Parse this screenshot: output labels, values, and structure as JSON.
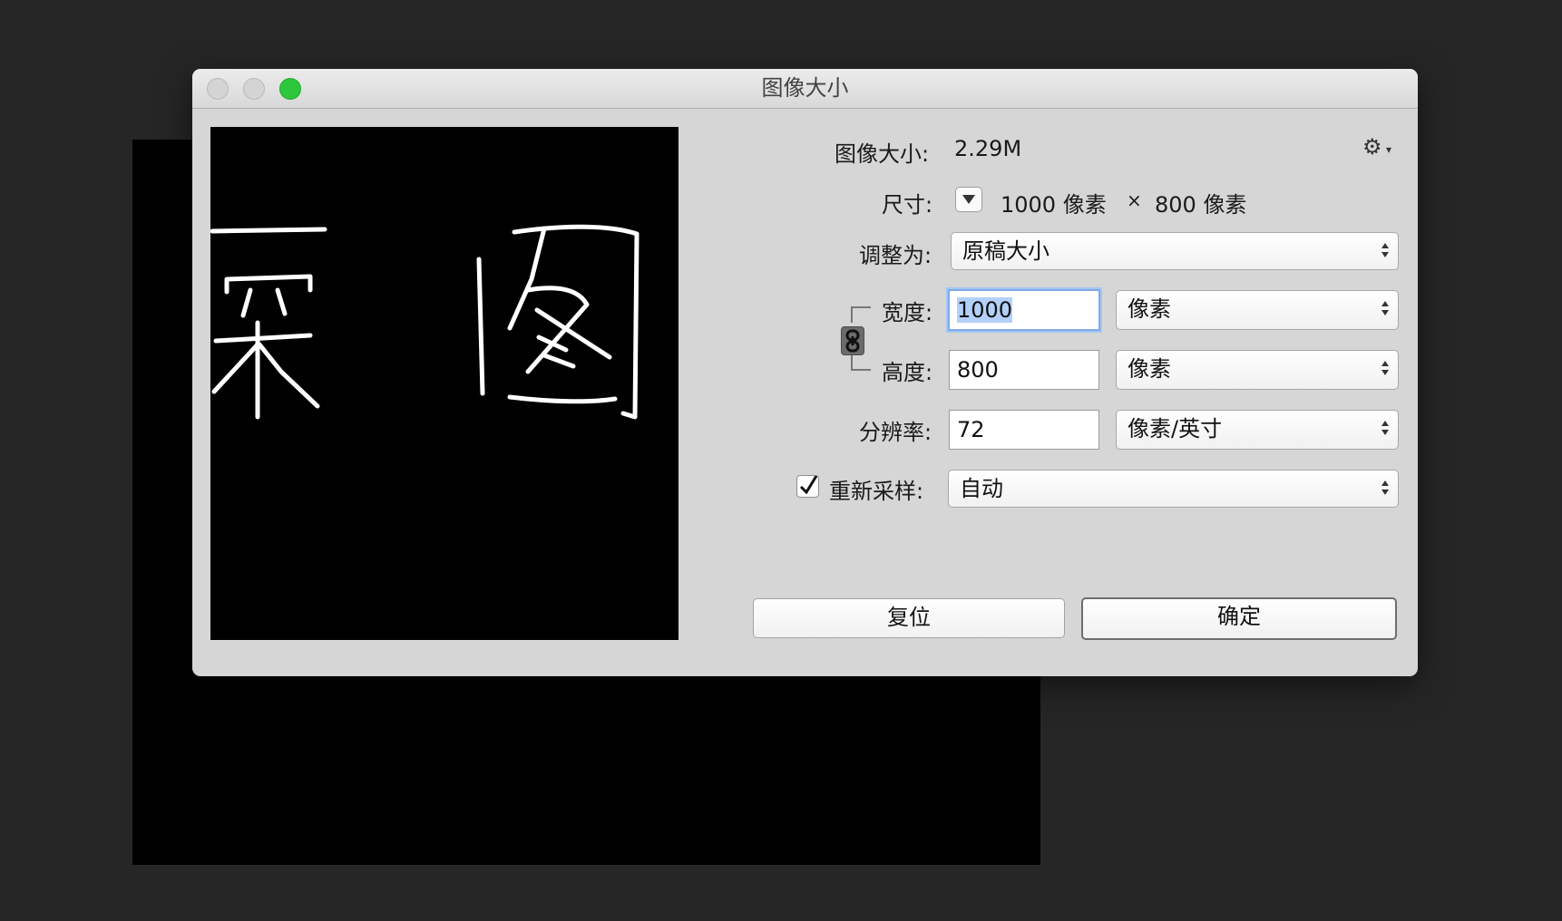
{
  "window": {
    "title": "图像大小"
  },
  "info": {
    "size_label": "图像大小:",
    "size_value": "2.29M",
    "dimensions_label": "尺寸:",
    "width_px": "1000 像素",
    "times": "×",
    "height_px": "800 像素"
  },
  "fit_to": {
    "label": "调整为:",
    "value": "原稿大小"
  },
  "width": {
    "label": "宽度:",
    "value": "1000",
    "unit": "像素"
  },
  "height": {
    "label": "高度:",
    "value": "800",
    "unit": "像素"
  },
  "resolution": {
    "label": "分辨率:",
    "value": "72",
    "unit": "像素/英寸"
  },
  "resample": {
    "label": "重新采样:",
    "checked": true,
    "value": "自动"
  },
  "buttons": {
    "reset": "复位",
    "ok": "确定"
  },
  "icons": [
    "gear-icon",
    "chevron-down-icon",
    "chain-link-icon",
    "checkmark-icon",
    "up-down-arrows-icon"
  ]
}
